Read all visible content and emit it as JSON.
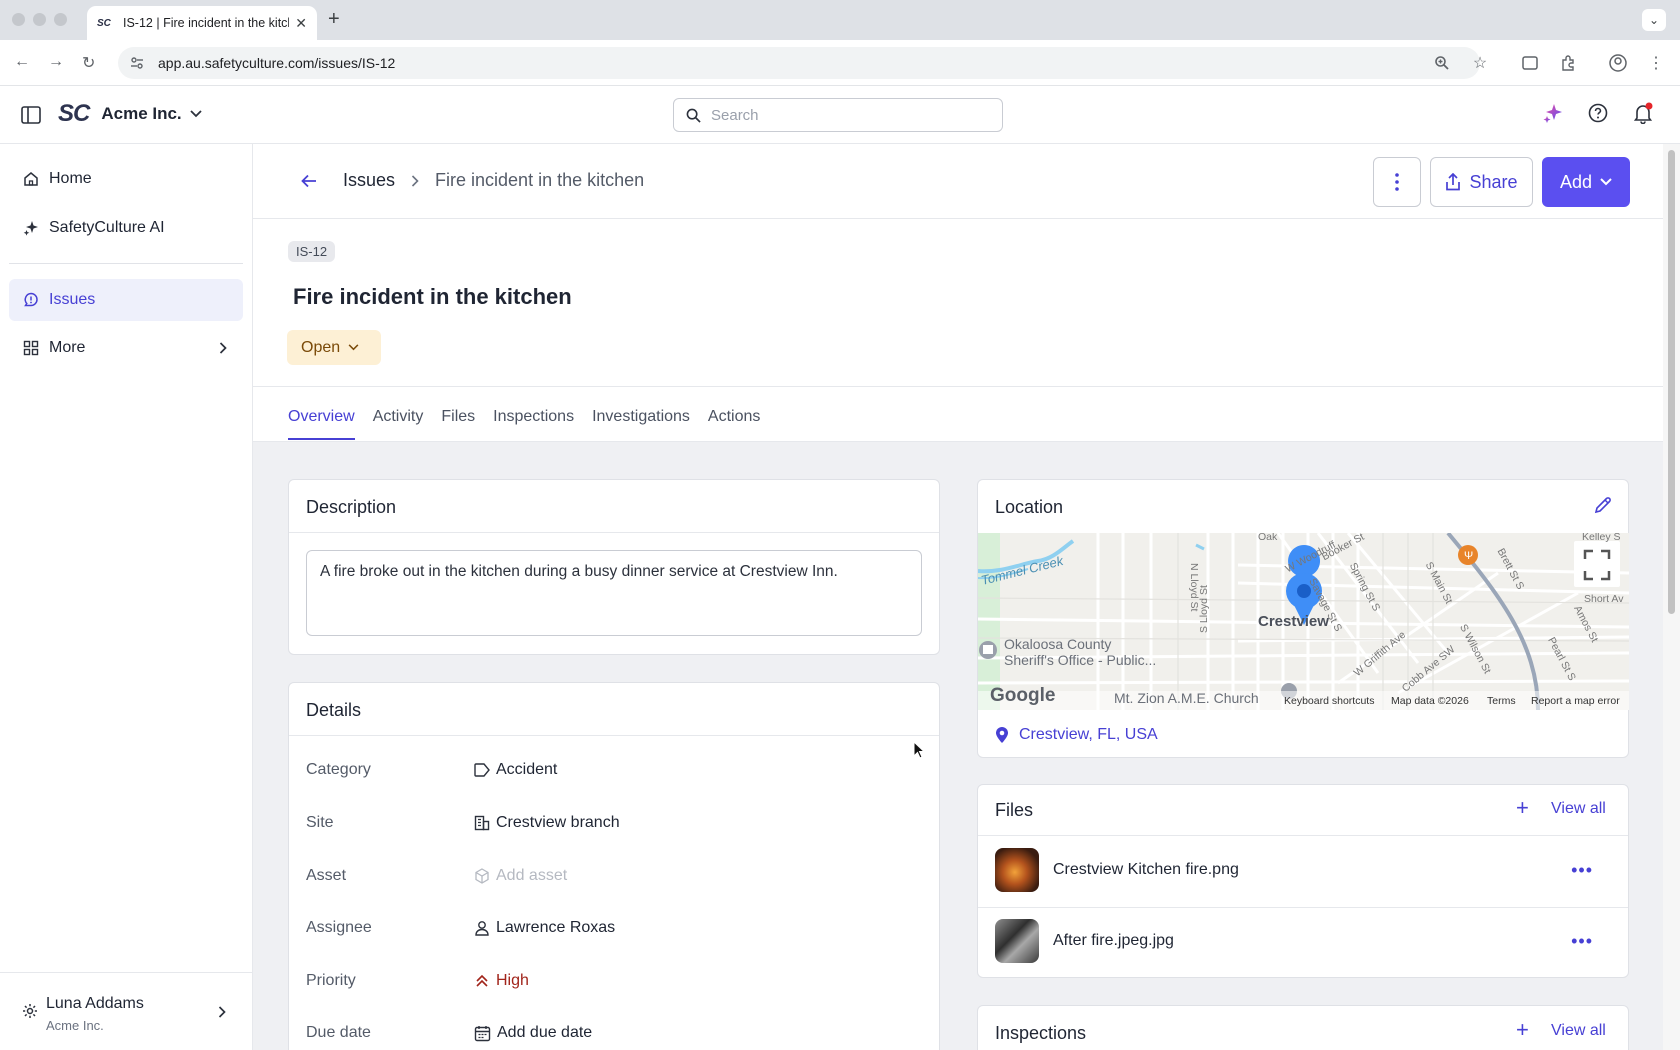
{
  "browser": {
    "tab_title": "IS-12 | Fire incident in the kitchen",
    "tab_favicon": "SC",
    "url": "app.au.safetyculture.com/issues/IS-12"
  },
  "header": {
    "logo": "SC",
    "org_name": "Acme Inc.",
    "search_placeholder": "Search"
  },
  "sidebar": {
    "items": [
      {
        "label": "Home",
        "icon": "home-icon"
      },
      {
        "label": "SafetyCulture AI",
        "icon": "sparkle-icon"
      },
      {
        "label": "Issues",
        "icon": "issue-icon",
        "active": true
      },
      {
        "label": "More",
        "icon": "grid-icon"
      }
    ],
    "user": {
      "name": "Luna Addams",
      "org": "Acme Inc."
    }
  },
  "breadcrumb": {
    "parent": "Issues",
    "current": "Fire incident in the kitchen"
  },
  "actions": {
    "share_label": "Share",
    "add_label": "Add"
  },
  "issue": {
    "id": "IS-12",
    "title": "Fire incident in the kitchen",
    "status": "Open"
  },
  "tabs": [
    "Overview",
    "Activity",
    "Files",
    "Inspections",
    "Investigations",
    "Actions"
  ],
  "description": {
    "title": "Description",
    "text": "A fire broke out in the kitchen during a busy dinner service at Crestview Inn."
  },
  "details": {
    "title": "Details",
    "rows": [
      {
        "label": "Category",
        "value": "Accident",
        "icon": "tag-icon"
      },
      {
        "label": "Site",
        "value": "Crestview branch",
        "icon": "building-icon"
      },
      {
        "label": "Asset",
        "value": "Add asset",
        "icon": "cube-icon"
      },
      {
        "label": "Assignee",
        "value": "Lawrence Roxas",
        "icon": "person-icon"
      },
      {
        "label": "Priority",
        "value": "High",
        "icon": "chevrons-up-icon"
      },
      {
        "label": "Due date",
        "value": "Add due date",
        "icon": "calendar-icon"
      }
    ]
  },
  "location": {
    "title": "Location",
    "address": "Crestview, FL, USA",
    "map": {
      "city_label": "Crestview",
      "poi_1": "Okaloosa County",
      "poi_1b": "Sheriff's Office - Public...",
      "poi_2": "Mt. Zion A.M.E. Church",
      "creek": "Tommel Creek",
      "streets": [
        "N Lloyd St",
        "S Lloyd St",
        "W Woodruff",
        "Booker St",
        "Spring St S",
        "Savage St S",
        "S Main St",
        "Brett St S",
        "Amos St",
        "Short Av",
        "Kelley S",
        "W Griffith Ave",
        "Cobb Ave SW",
        "S Wilson St",
        "Pearl St S",
        "Oak"
      ],
      "attribution": "Google",
      "footer": [
        "Keyboard shortcuts",
        "Map data ©2026",
        "Terms",
        "Report a map error"
      ]
    }
  },
  "files": {
    "title": "Files",
    "view_all": "View all",
    "items": [
      {
        "name": "Crestview Kitchen fire.png"
      },
      {
        "name": "After fire.jpeg.jpg"
      }
    ]
  },
  "inspections": {
    "title": "Inspections",
    "view_all": "View all"
  },
  "colors": {
    "accent": "#4740d4",
    "primary_button": "#5b4ff0",
    "status_bg": "#fdf0d5",
    "priority_high": "#a1241a"
  }
}
